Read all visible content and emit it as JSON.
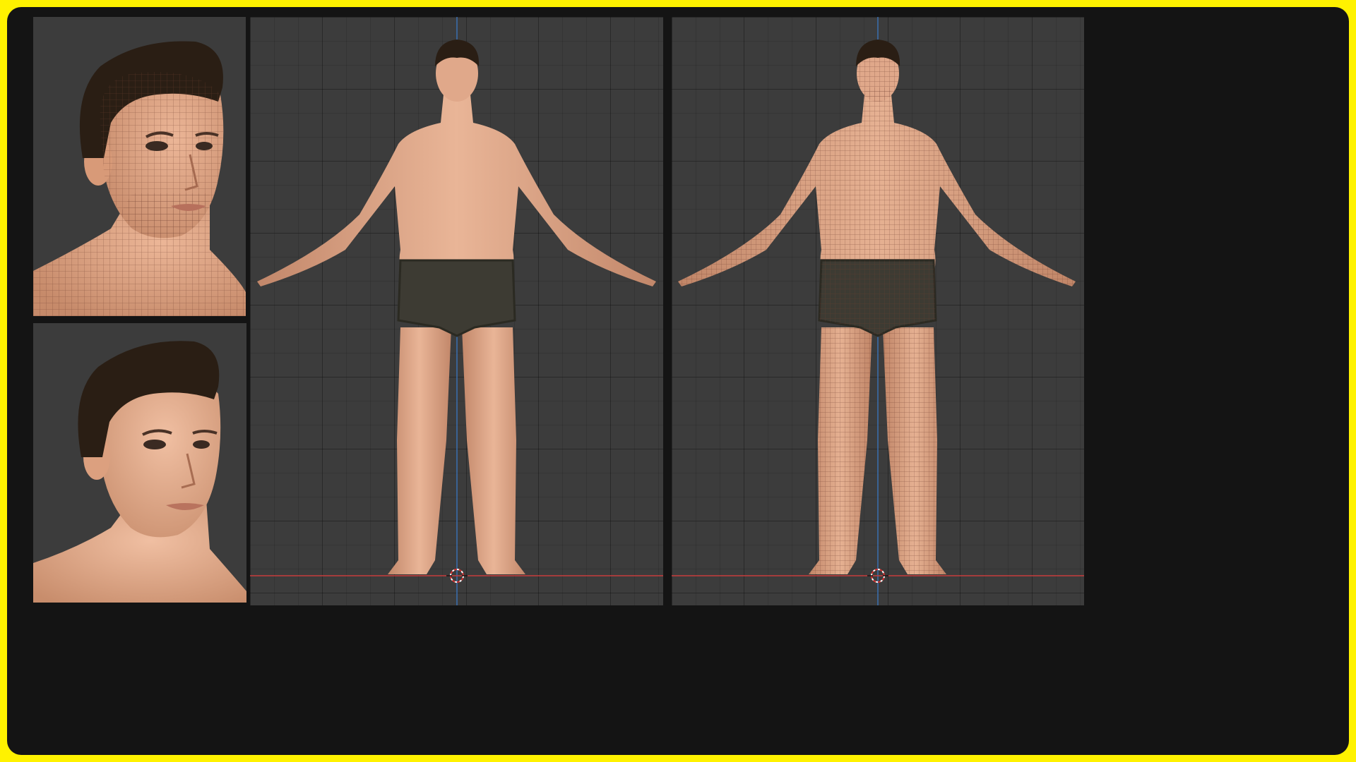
{
  "title": "",
  "panels": {
    "head_wireframe": {
      "view": "head-closeup",
      "shading": "wireframe-overlay"
    },
    "head_rendered": {
      "view": "head-closeup",
      "shading": "rendered"
    },
    "body_rendered": {
      "view": "front-orthographic",
      "shading": "rendered",
      "pose": "A-pose"
    },
    "body_wireframe": {
      "view": "front-orthographic",
      "shading": "wireframe-overlay",
      "pose": "A-pose"
    }
  },
  "viewport": {
    "grid": true,
    "x_axis_color": "#c83c3c",
    "z_axis_color": "#3a6fb0",
    "origin_marker": "3d-cursor-icon"
  },
  "colors": {
    "border": "#fff200",
    "frame": "#141414",
    "panel_bg": "#3c3c3c",
    "skin": "#e0a583",
    "skin_shade": "#b97a5c",
    "hair": "#2a1e14",
    "underwear": "#3d3b33",
    "wire": "#7a4a3a"
  }
}
